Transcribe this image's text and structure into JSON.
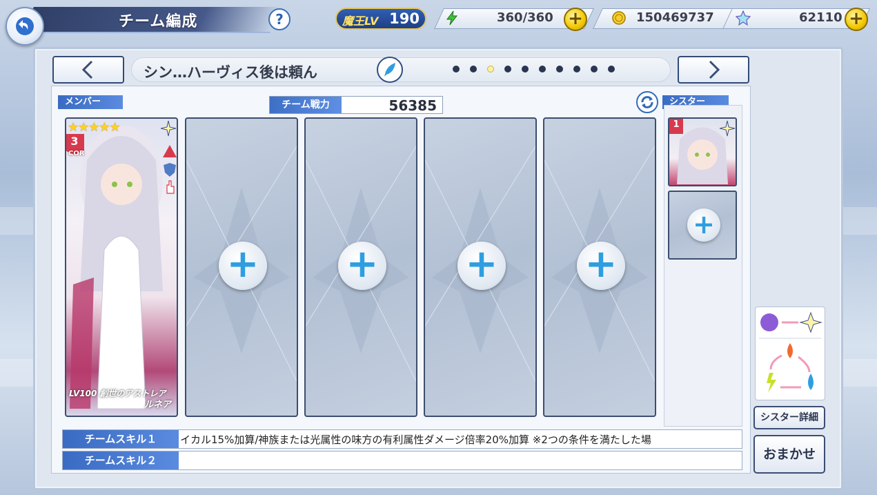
{
  "header": {
    "title": "チーム編成",
    "help_icon": "?",
    "level_label": "魔王LV",
    "level_value": "190",
    "stamina": "360/360",
    "gold": "150469737",
    "gems": "62110",
    "plus_glyph": "+"
  },
  "team": {
    "name": "シン…ハーヴィス後は頼ん",
    "page_count": 10,
    "active_page": 3,
    "power_label": "チーム戦力",
    "power_value": "56385"
  },
  "labels": {
    "members": "メンバー",
    "sister": "シスター"
  },
  "member": {
    "stars": "★★★★★",
    "rank": "3",
    "rank_suffix": "COR",
    "level": "LV100",
    "title": "創世のアストレア",
    "name": "ルネア"
  },
  "sister_card": {
    "rank": "1"
  },
  "empty_slot_glyph": "+",
  "skills": [
    {
      "label": "チームスキル１",
      "text": "イカル15%加算/神族または光属性の味方の有利属性ダメージ倍率20%加算 ※2つの条件を満たした場"
    },
    {
      "label": "チームスキル２",
      "text": ""
    }
  ],
  "buttons": {
    "sister_detail": "シスター詳細",
    "auto": "おまかせ"
  },
  "colors": {
    "accent_blue": "#3a6bc2",
    "plus_blue": "#2f9ee0",
    "coin_gold": "#f2c800"
  }
}
